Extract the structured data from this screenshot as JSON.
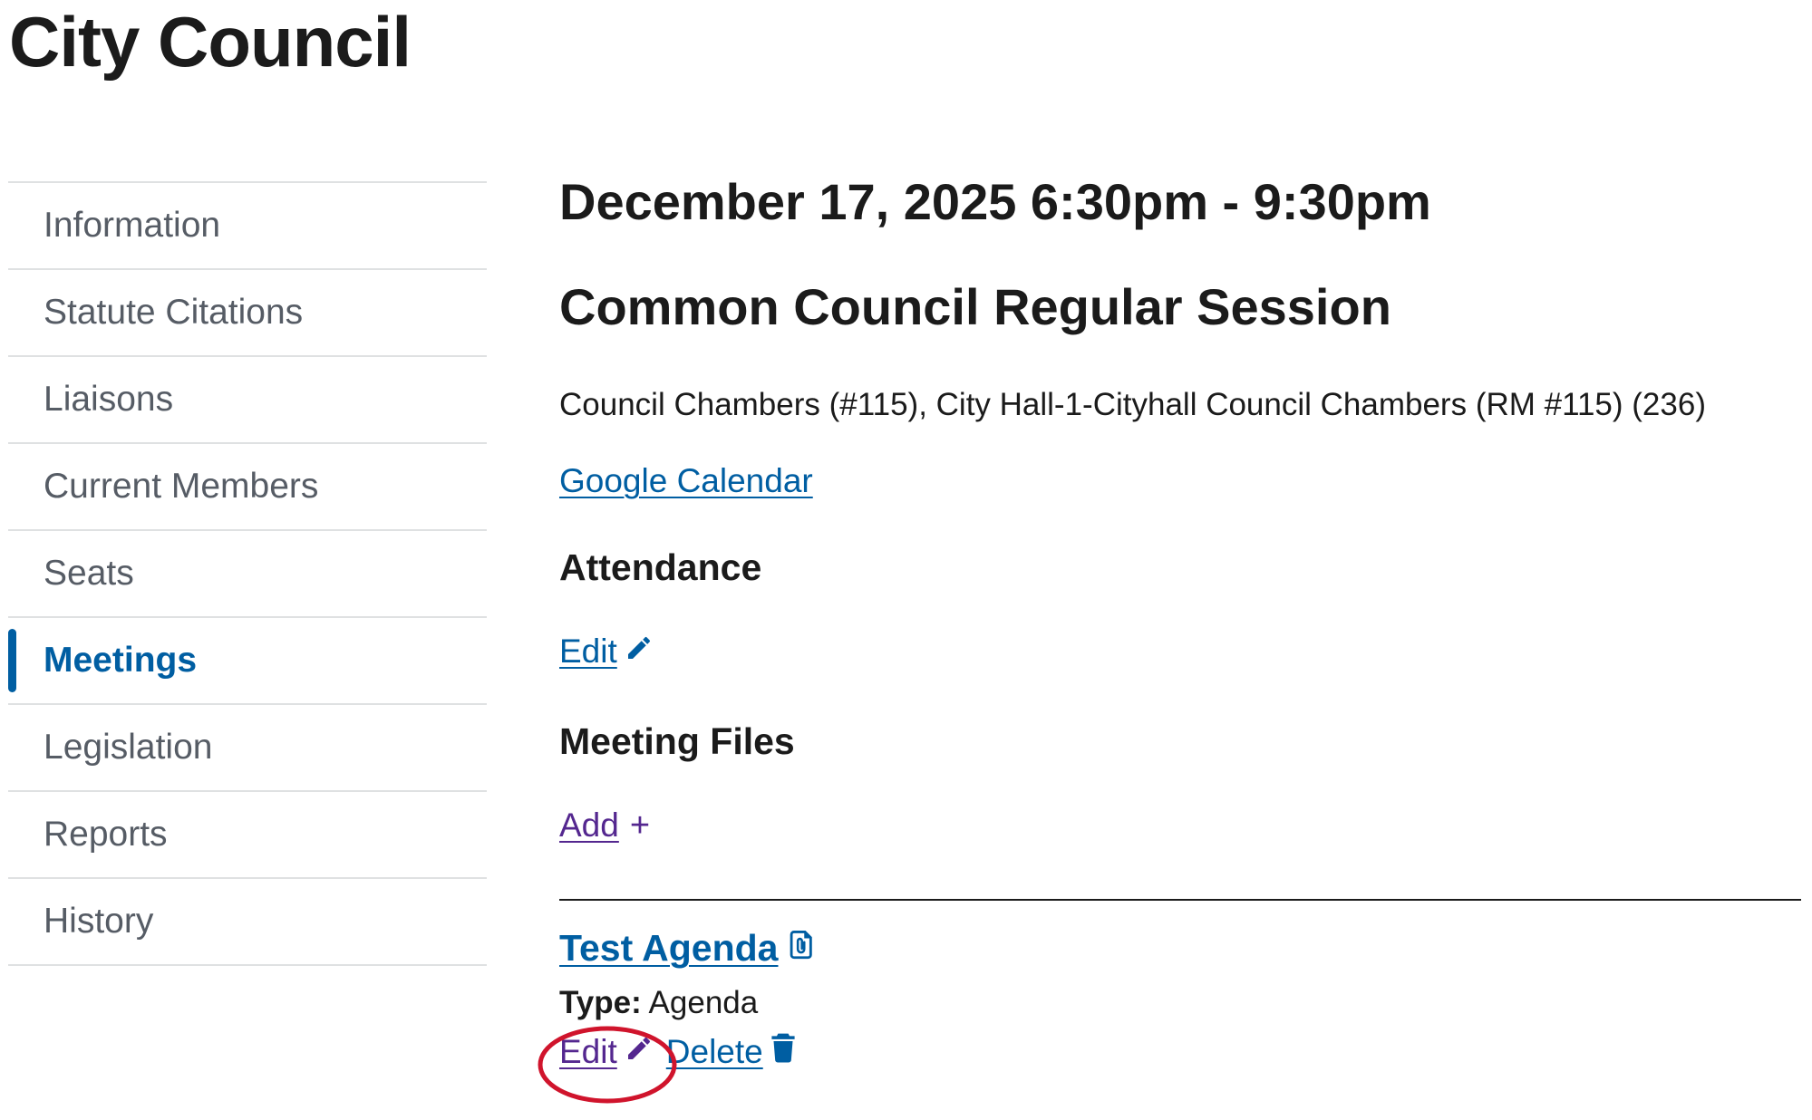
{
  "page": {
    "title": "City Council"
  },
  "sidebar": {
    "items": [
      {
        "label": "Information",
        "active": false
      },
      {
        "label": "Statute Citations",
        "active": false
      },
      {
        "label": "Liaisons",
        "active": false
      },
      {
        "label": "Current Members",
        "active": false
      },
      {
        "label": "Seats",
        "active": false
      },
      {
        "label": "Meetings",
        "active": true
      },
      {
        "label": "Legislation",
        "active": false
      },
      {
        "label": "Reports",
        "active": false
      },
      {
        "label": "History",
        "active": false
      }
    ]
  },
  "meeting": {
    "datetime": "December 17, 2025 6:30pm - 9:30pm",
    "title": "Common Council Regular Session",
    "location": "Council Chambers (#115), City Hall-1-Cityhall Council Chambers (RM #115) (236)",
    "calendar_link": "Google Calendar"
  },
  "attendance": {
    "heading": "Attendance",
    "edit_label": "Edit",
    "edit_icon": "pencil-icon"
  },
  "files": {
    "heading": "Meeting Files",
    "add_label": "Add",
    "add_icon": "+",
    "items": [
      {
        "title": "Test Agenda",
        "title_icon": "attachment-icon",
        "type_label": "Type:",
        "type_value": "Agenda",
        "edit_label": "Edit",
        "edit_icon": "pencil-icon",
        "delete_label": "Delete",
        "delete_icon": "trash-icon"
      }
    ]
  },
  "annotation": {
    "highlight_color": "#d0142c",
    "highlights": "file edit link"
  },
  "colors": {
    "link": "#005ea2",
    "visited_link": "#54278f",
    "active_nav": "#005ea2",
    "nav_text": "#565c65",
    "text": "#1b1b1b"
  }
}
